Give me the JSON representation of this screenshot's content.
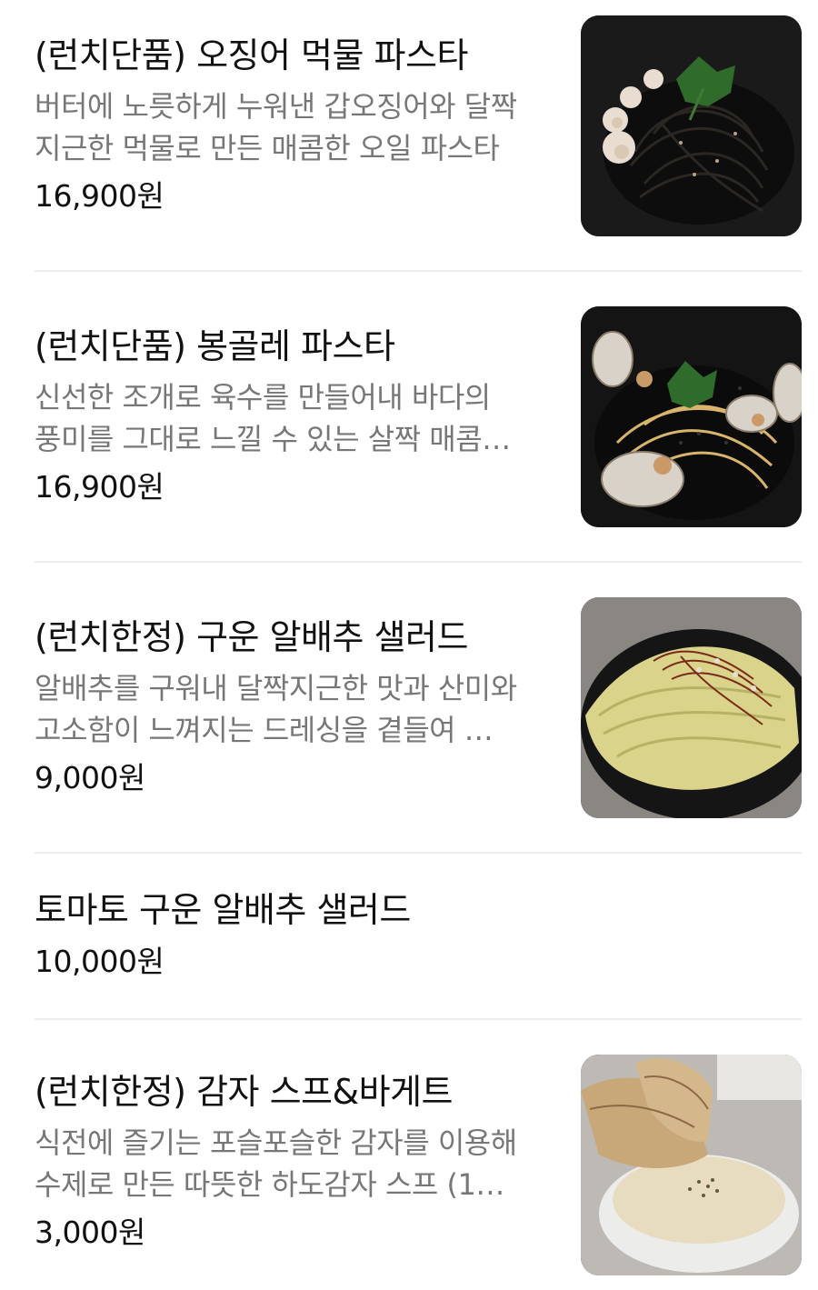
{
  "menu": {
    "items": [
      {
        "name": "(런치단품) 오징어 먹물 파스타",
        "desc_line1": "버터에 노릇하게 누워낸 갑오징어와 달짝",
        "desc_line2": "지근한 먹물로 만든 매콤한 오일 파스타",
        "price": "16,900원",
        "image_icon": "squid-ink-pasta-photo"
      },
      {
        "name": "(런치단품) 봉골레 파스타",
        "desc_line1": "신선한 조개로 육수를 만들어내 바다의",
        "desc_line2": "풍미를 그대로 느낄 수 있는 살짝 매콤…",
        "price": "16,900원",
        "image_icon": "vongole-pasta-photo"
      },
      {
        "name": "(런치한정) 구운 알배추 샐러드",
        "desc_line1": "알배추를 구워내 달짝지근한 맛과 산미와",
        "desc_line2": "고소함이 느껴지는 드레싱을 곁들여 …",
        "price": "9,000원",
        "image_icon": "grilled-cabbage-salad-photo"
      },
      {
        "name": "토마토 구운 알배추 샐러드",
        "price": "10,000원"
      },
      {
        "name": "(런치한정) 감자 스프&바게트",
        "desc_line1": "식전에 즐기는 포슬포슬한 감자를 이용해",
        "desc_line2": "수제로 만든 따뜻한 하도감자 스프 (1…",
        "price": "3,000원",
        "image_icon": "potato-soup-baguette-photo"
      }
    ]
  },
  "colors": {
    "text_primary": "#111111",
    "text_secondary": "#777777",
    "divider": "#eeeeee",
    "background": "#ffffff"
  }
}
